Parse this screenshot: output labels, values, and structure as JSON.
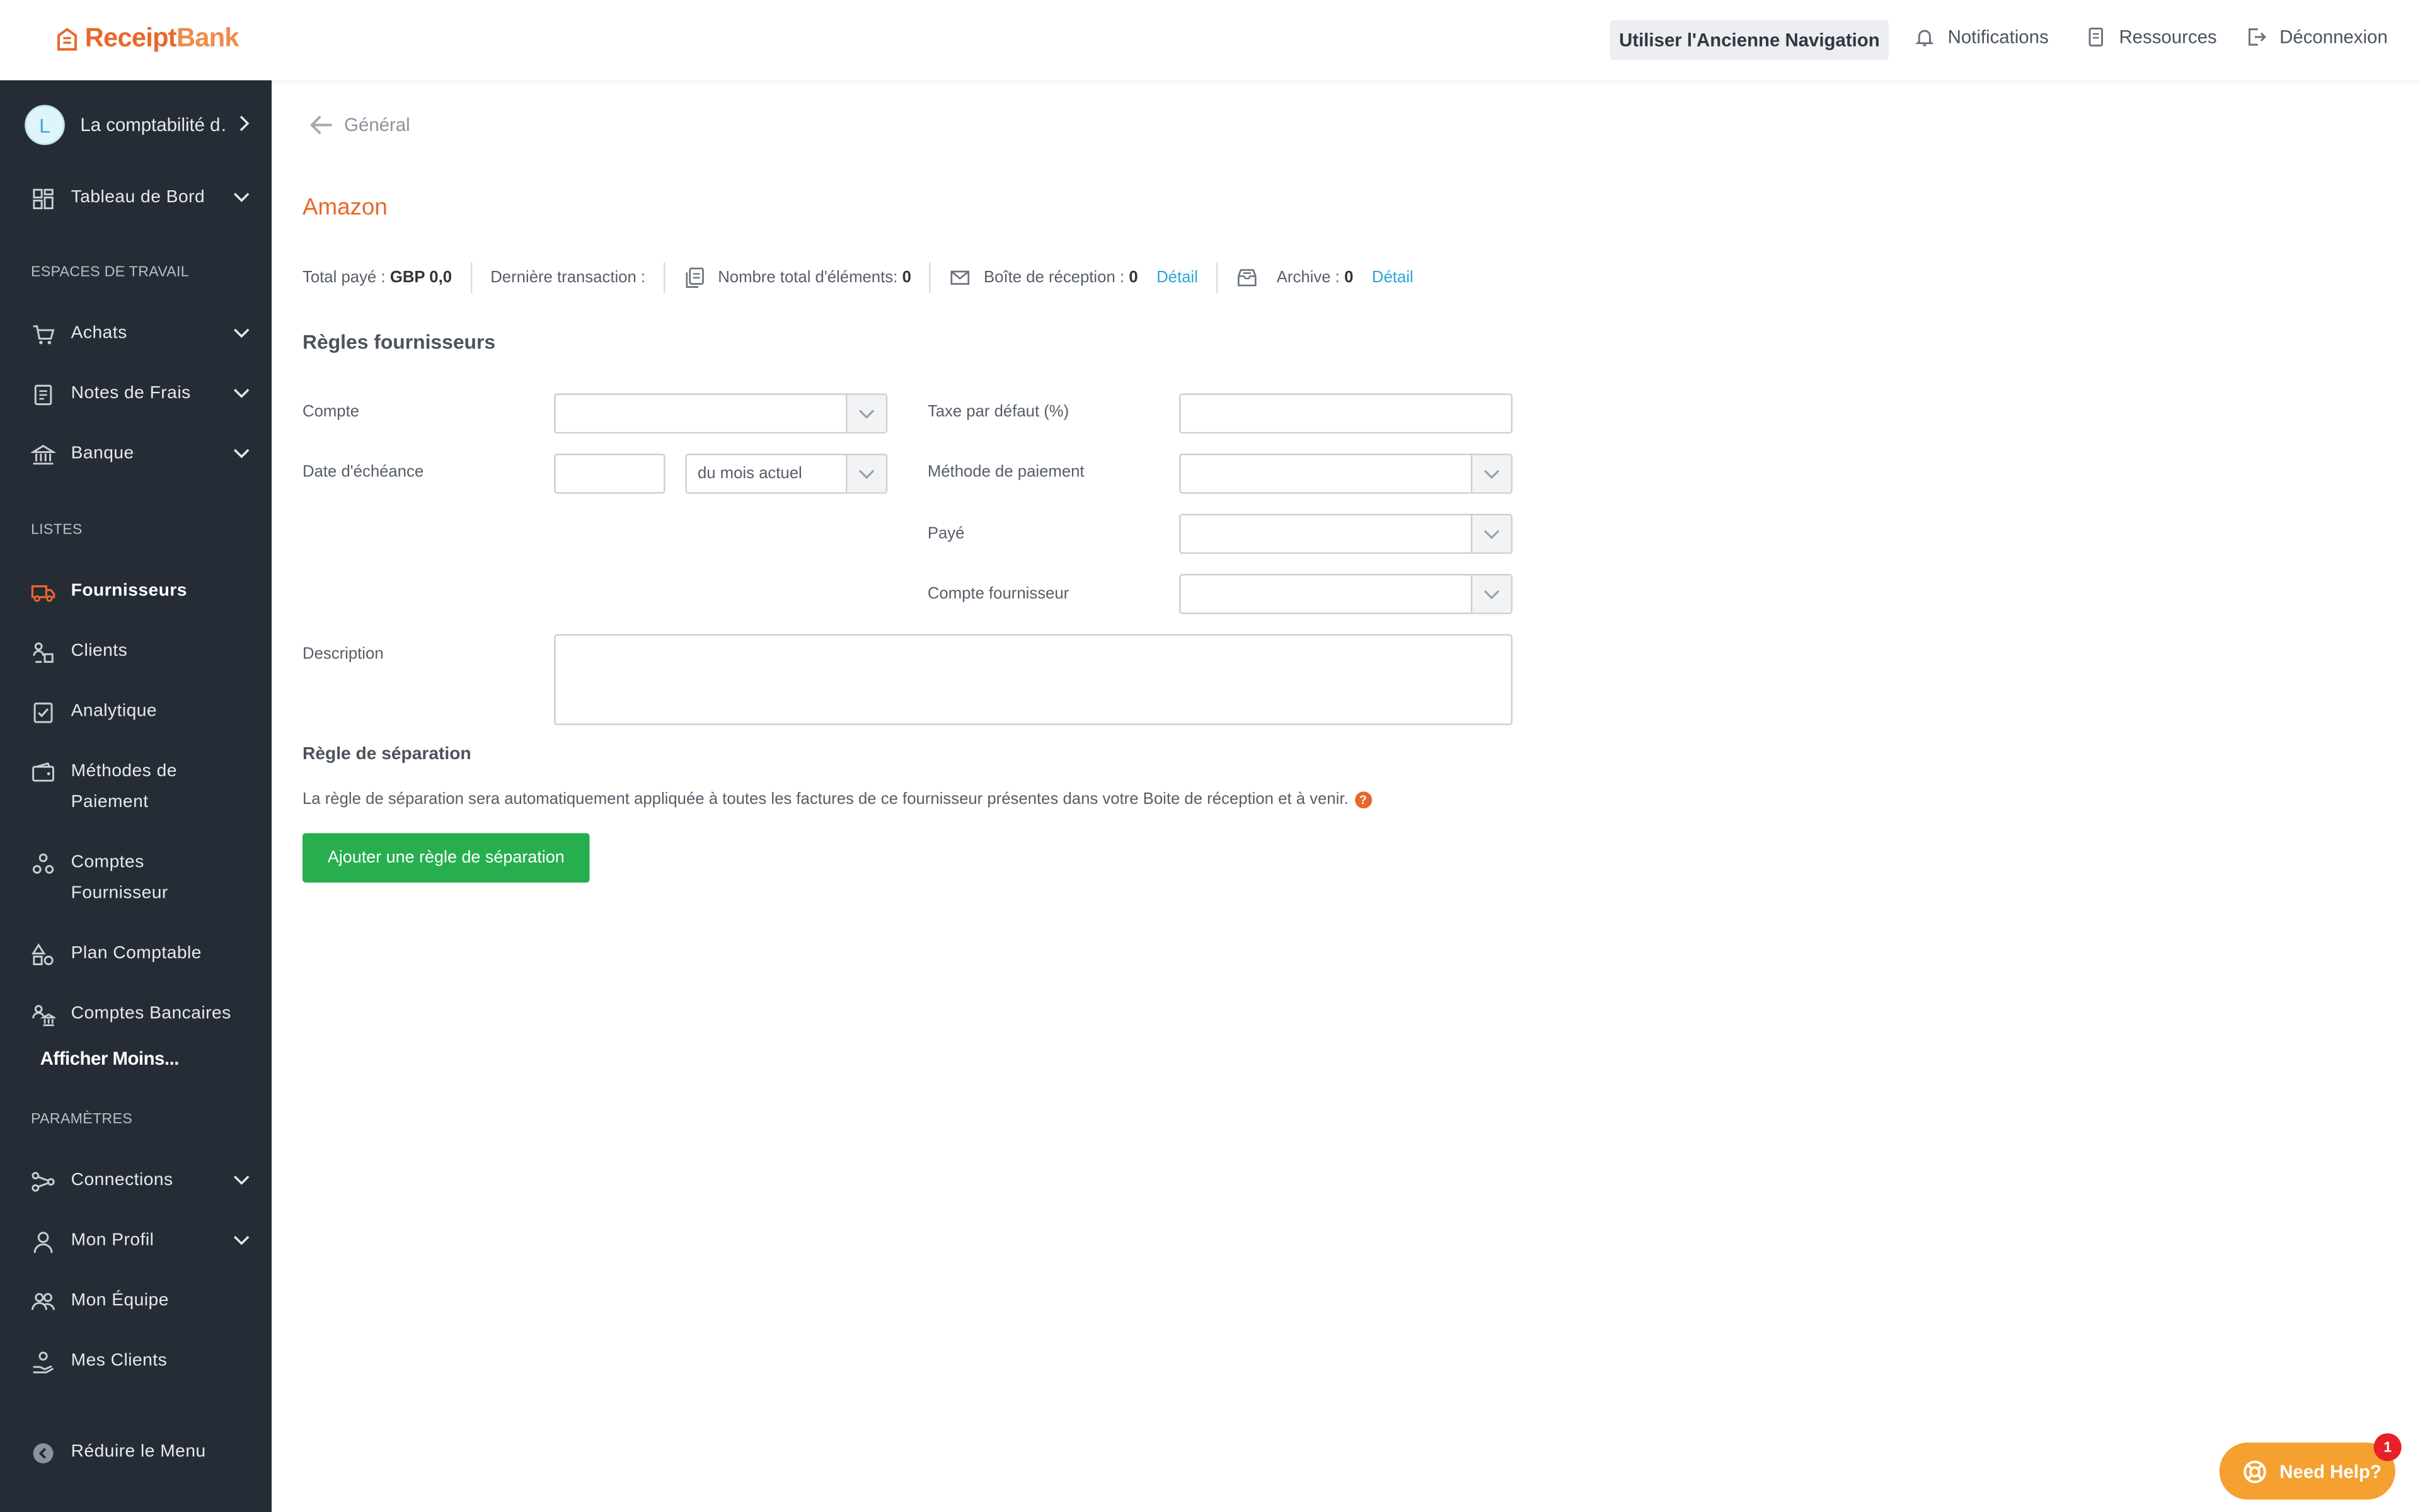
{
  "header": {
    "logo_receipt": "Receipt",
    "logo_bank": "Bank",
    "old_nav_label": "Utiliser l'Ancienne Navigation",
    "notifications_label": "Notifications",
    "resources_label": "Ressources",
    "logout_label": "Déconnexion"
  },
  "sidebar": {
    "org_initial": "L",
    "org_name": "La comptabilité d…",
    "dashboard": "Tableau de Bord",
    "section_workspaces": "ESPACES DE TRAVAIL",
    "purchases": "Achats",
    "expenses": "Notes de Frais",
    "bank": "Banque",
    "section_lists": "LISTES",
    "suppliers": "Fournisseurs",
    "clients": "Clients",
    "analytics": "Analytique",
    "payment_methods_1": "Méthodes de",
    "payment_methods_2": "Paiement",
    "supplier_accounts_1": "Comptes",
    "supplier_accounts_2": "Fournisseur",
    "chart_of_accounts": "Plan Comptable",
    "bank_accounts": "Comptes Bancaires",
    "show_less": "Afficher Moins...",
    "section_settings": "PARAMÈTRES",
    "connections": "Connections",
    "my_profile": "Mon Profil",
    "my_team": "Mon Équipe",
    "my_clients": "Mes Clients",
    "collapse_menu": "Réduire le Menu"
  },
  "main": {
    "back_label": "Général",
    "supplier_name": "Amazon",
    "stats": {
      "total_paid_label": "Total payé :",
      "total_paid_value": "GBP 0,0",
      "last_transaction_label": "Dernière transaction :",
      "total_items_label": "Nombre total d'éléments:",
      "total_items_value": "0",
      "inbox_label": "Boîte de réception :",
      "inbox_value": "0",
      "inbox_link": "Détail",
      "archive_label": "Archive :",
      "archive_value": "0",
      "archive_link": "Détail"
    },
    "rules_title": "Règles fournisseurs",
    "form": {
      "account_label": "Compte",
      "account_value": "",
      "due_date_label": "Date d'échéance",
      "due_date_value": "",
      "due_date_period": "du mois actuel",
      "default_tax_label": "Taxe par défaut (%)",
      "default_tax_value": "",
      "payment_method_label": "Méthode de paiement",
      "payment_method_value": "",
      "paid_label": "Payé",
      "paid_value": "",
      "supplier_account_label": "Compte fournisseur",
      "supplier_account_value": "",
      "description_label": "Description",
      "description_value": ""
    },
    "split_title": "Règle de séparation",
    "split_description": "La règle de séparation sera automatiquement appliquée à toutes les factures de ce fournisseur présentes dans votre Boite de réception et à venir.",
    "split_help_icon": "?",
    "add_split_label": "Ajouter une règle de séparation"
  },
  "help_widget": {
    "label": "Need Help?",
    "badge": "1"
  },
  "colors": {
    "brand": "#e8672a",
    "sidebar_bg": "#262c36",
    "primary_button": "#27ae4f",
    "link": "#2aa6d9",
    "help": "#f5a030"
  }
}
